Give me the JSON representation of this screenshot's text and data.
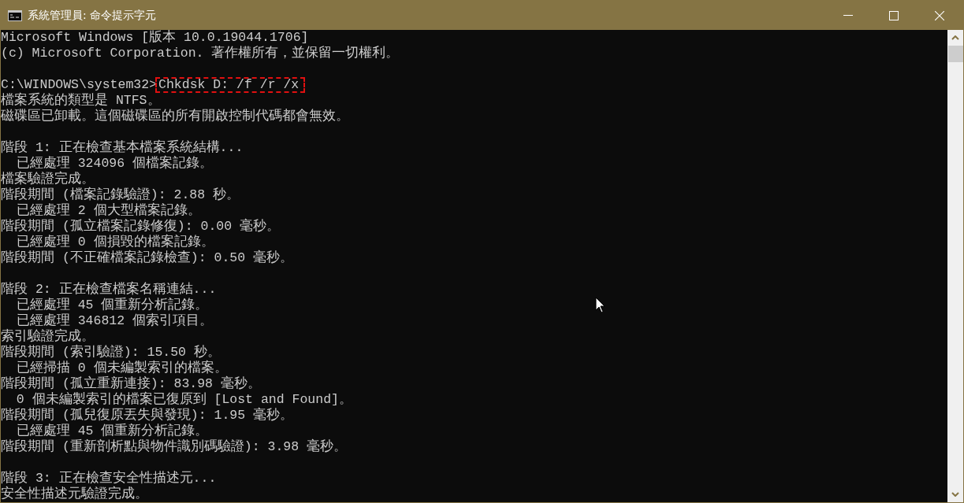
{
  "window": {
    "title": "系統管理員: 命令提示字元"
  },
  "lines": [
    {
      "kind": "output",
      "text": "Microsoft Windows [版本 10.0.19044.1706]"
    },
    {
      "kind": "output",
      "text": "(c) Microsoft Corporation. 著作權所有，並保留一切權利。"
    },
    {
      "kind": "blank"
    },
    {
      "kind": "prompt",
      "prompt": "C:\\WINDOWS\\system32>",
      "command": "Chkdsk D: /f /r /x",
      "highlighted": true
    },
    {
      "kind": "output",
      "text": "檔案系統的類型是 NTFS。"
    },
    {
      "kind": "output",
      "text": "磁碟區已卸載。這個磁碟區的所有開啟控制代碼都會無效。"
    },
    {
      "kind": "blank"
    },
    {
      "kind": "output",
      "text": "階段 1: 正在檢查基本檔案系統結構..."
    },
    {
      "kind": "output",
      "text": "  已經處理 324096 個檔案記錄。"
    },
    {
      "kind": "output",
      "text": "檔案驗證完成。"
    },
    {
      "kind": "output",
      "text": "階段期間 (檔案記錄驗證): 2.88 秒。"
    },
    {
      "kind": "output",
      "text": "  已經處理 2 個大型檔案記錄。"
    },
    {
      "kind": "output",
      "text": "階段期間 (孤立檔案記錄修復): 0.00 毫秒。"
    },
    {
      "kind": "output",
      "text": "  已經處理 0 個損毀的檔案記錄。"
    },
    {
      "kind": "output",
      "text": "階段期間 (不正確檔案記錄檢查): 0.50 毫秒。"
    },
    {
      "kind": "blank"
    },
    {
      "kind": "output",
      "text": "階段 2: 正在檢查檔案名稱連結..."
    },
    {
      "kind": "output",
      "text": "  已經處理 45 個重新分析記錄。"
    },
    {
      "kind": "output",
      "text": "  已經處理 346812 個索引項目。"
    },
    {
      "kind": "output",
      "text": "索引驗證完成。"
    },
    {
      "kind": "output",
      "text": "階段期間 (索引驗證): 15.50 秒。"
    },
    {
      "kind": "output",
      "text": "  已經掃描 0 個未編製索引的檔案。"
    },
    {
      "kind": "output",
      "text": "階段期間 (孤立重新連接): 83.98 毫秒。"
    },
    {
      "kind": "output",
      "text": "  0 個未編製索引的檔案已復原到 [Lost and Found]。"
    },
    {
      "kind": "output",
      "text": "階段期間 (孤兒復原丟失與發現): 1.95 毫秒。"
    },
    {
      "kind": "output",
      "text": "  已經處理 45 個重新分析記錄。"
    },
    {
      "kind": "output",
      "text": "階段期間 (重新剖析點與物件識別碼驗證): 3.98 毫秒。"
    },
    {
      "kind": "blank"
    },
    {
      "kind": "output",
      "text": "階段 3: 正在檢查安全性描述元..."
    },
    {
      "kind": "output",
      "text": "安全性描述元驗證完成。"
    }
  ]
}
